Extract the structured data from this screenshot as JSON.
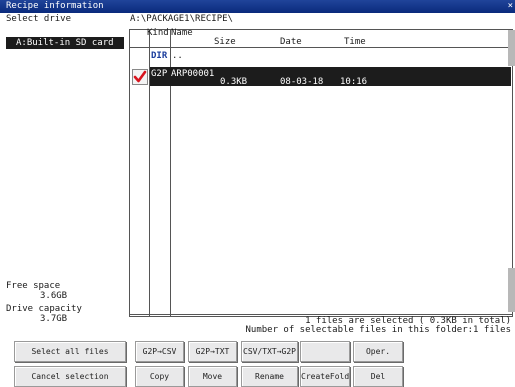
{
  "window": {
    "title": "Recipe information",
    "close_icon": "×"
  },
  "left": {
    "select_drive_label": "Select drive",
    "drive_option": "A:Built-in SD card",
    "free_space_label": "Free space",
    "free_space_value": "3.6GB",
    "capacity_label": "Drive capacity",
    "capacity_value": "3.7GB"
  },
  "file_browser": {
    "path": "A:\\PACKAGE1\\RECIPE\\",
    "headers": {
      "kind": "Kind",
      "name": "Name",
      "size": "Size",
      "date": "Date",
      "time": "Time"
    },
    "rows": [
      {
        "kind": "DIR",
        "name": "..",
        "size": "",
        "date": "",
        "time": ""
      },
      {
        "kind": "G2P",
        "name": "ARP00001",
        "size": "0.3KB",
        "date": "08-03-18",
        "time": "10:16",
        "selected": true
      }
    ]
  },
  "status": {
    "line1": "1 files are selected (   0.3KB in total)",
    "line2": "Number of selectable files in this folder:1 files"
  },
  "buttons": {
    "select_all": "Select all files",
    "cancel_selection": "Cancel selection",
    "g2p_csv": "G2P→CSV",
    "g2p_txt": "G2P→TXT",
    "csvtxt_g2p": "CSV/TXT→G2P",
    "blank": "",
    "oper": "Oper.",
    "copy": "Copy",
    "move": "Move",
    "rename": "Rename",
    "create_folder": "CreateFolder",
    "del": "Del"
  },
  "colors": {
    "title_bar": "#0a2a7c",
    "selection": "#1c1c1c",
    "dir_tag": "#1a3c9c",
    "check_mark": "#d8141e"
  }
}
